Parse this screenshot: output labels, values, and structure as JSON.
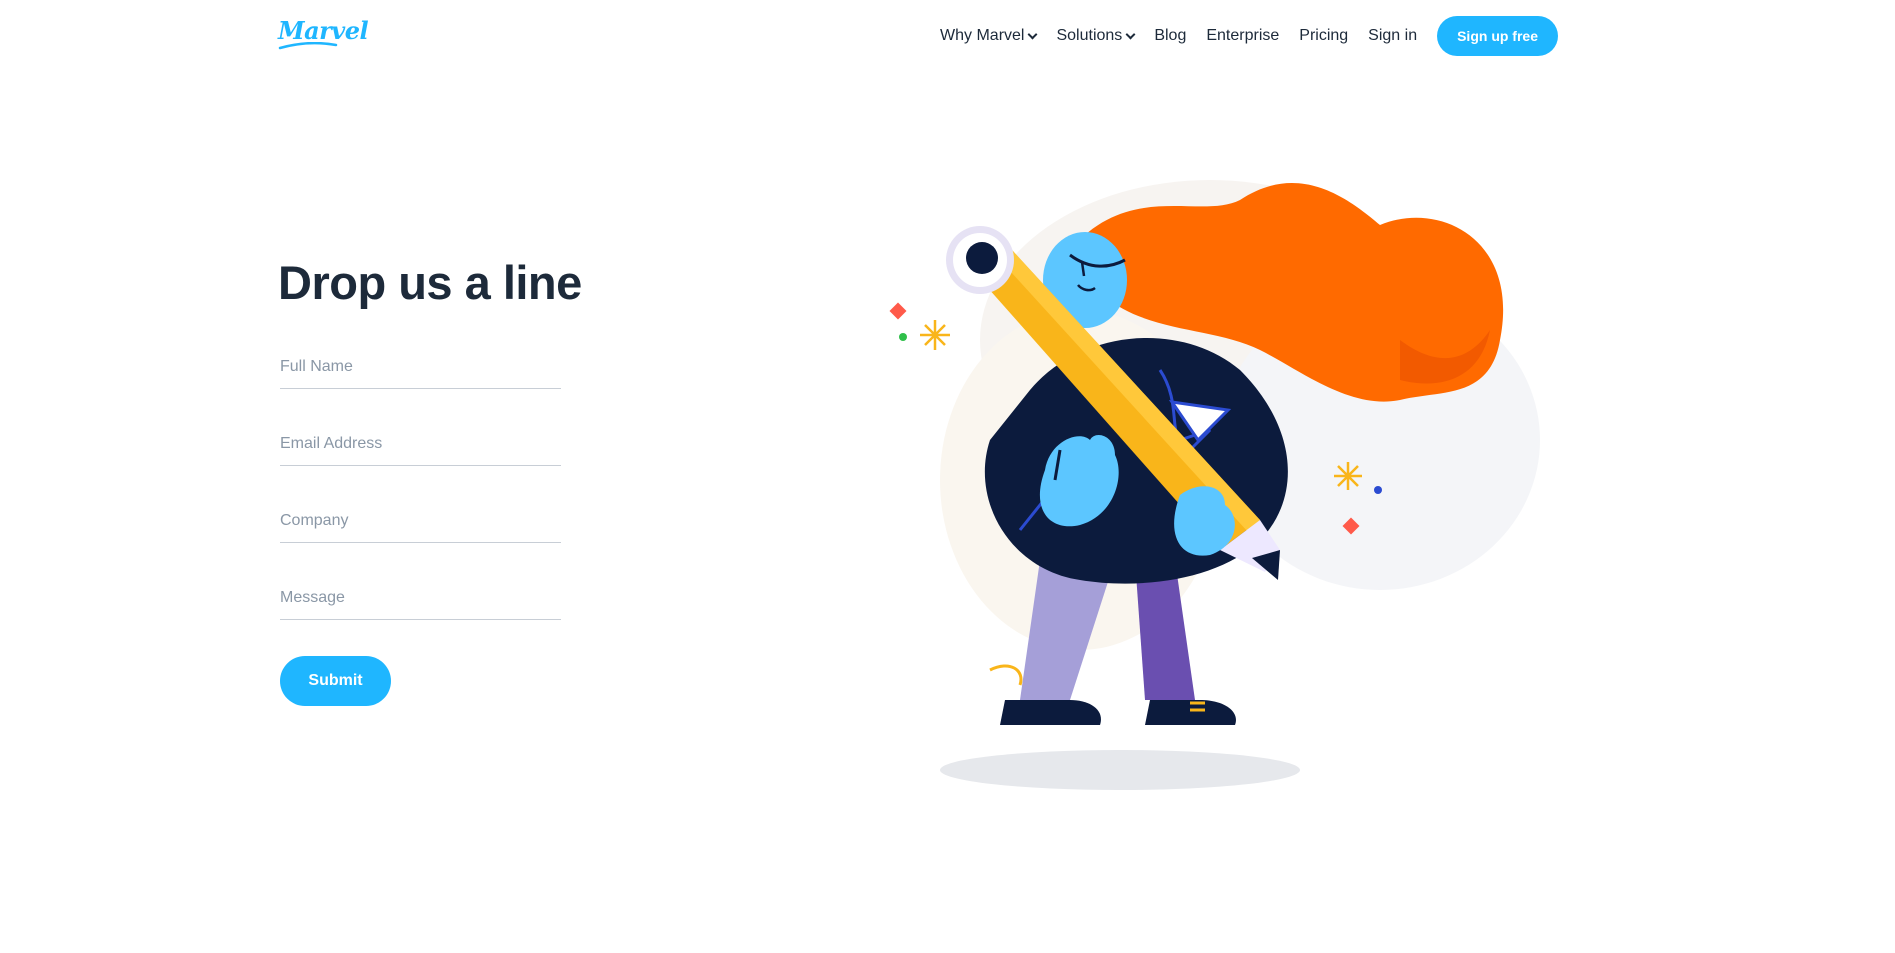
{
  "nav": {
    "logo_text": "Marvel",
    "items": [
      {
        "label": "Why Marvel",
        "has_dropdown": true
      },
      {
        "label": "Solutions",
        "has_dropdown": true
      },
      {
        "label": "Blog",
        "has_dropdown": false
      },
      {
        "label": "Enterprise",
        "has_dropdown": false
      },
      {
        "label": "Pricing",
        "has_dropdown": false
      },
      {
        "label": "Sign in",
        "has_dropdown": false
      }
    ],
    "cta_label": "Sign up free"
  },
  "contact": {
    "heading": "Drop us a line",
    "fields": {
      "full_name": {
        "placeholder": "Full Name",
        "value": ""
      },
      "email": {
        "placeholder": "Email Address",
        "value": ""
      },
      "company": {
        "placeholder": "Company",
        "value": ""
      },
      "message": {
        "placeholder": "Message",
        "value": ""
      }
    },
    "submit_label": "Submit"
  },
  "colors": {
    "accent": "#1fb6ff",
    "heading": "#1d2a3a",
    "hair": "#ff6a00",
    "pencil": "#f9b51a",
    "navy": "#0c1b3d"
  },
  "illustration": {
    "subject": "woman-carrying-pencil"
  }
}
